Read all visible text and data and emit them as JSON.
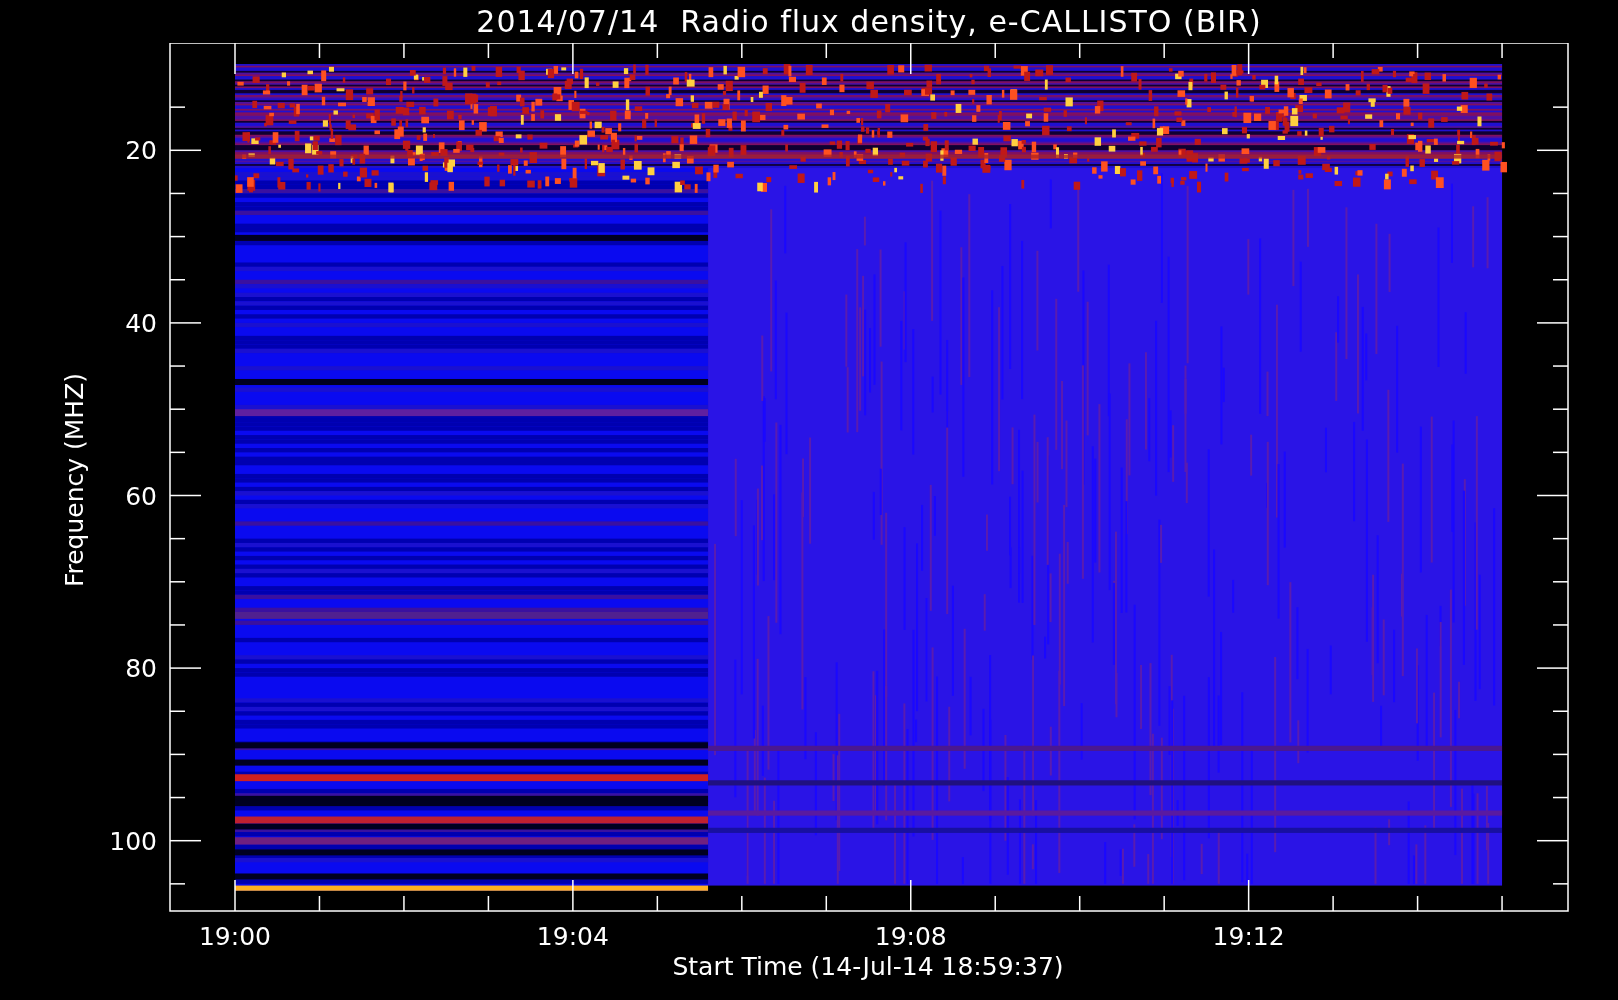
{
  "title": "2014/07/14  Radio flux density, e-CALLISTO (BIR)",
  "xlabel": "Start Time (14-Jul-14 18:59:37)",
  "ylabel": "Frequency (MHZ)",
  "xticks": [
    "19:00",
    "19:04",
    "19:08",
    "19:12"
  ],
  "yticks": [
    "20",
    "40",
    "60",
    "80",
    "100"
  ]
}
